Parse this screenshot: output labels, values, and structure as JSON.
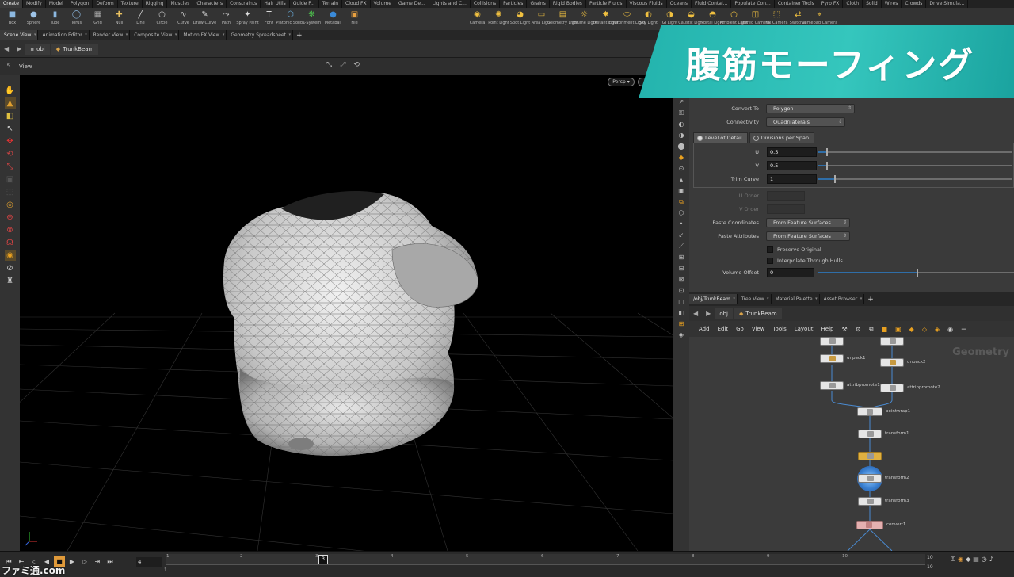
{
  "shelf_tabs": [
    "Create",
    "Modify",
    "Model",
    "Polygon",
    "Deform",
    "Texture",
    "Rigging",
    "Muscles",
    "Characters",
    "Constraints",
    "Hair Utils",
    "Guide P...",
    "Terrain",
    "Cloud FX",
    "Volume",
    "Game De...",
    "Lights and C...",
    "Collisions",
    "Particles",
    "Grains",
    "Rigid Bodies",
    "Particle Fluids",
    "Viscous Fluids",
    "Oceans",
    "Fluid Contai...",
    "Populate Con...",
    "Container Tools",
    "Pyro FX",
    "Cloth",
    "Solid",
    "Wires",
    "Crowds",
    "Drive Simula..."
  ],
  "shelf_tools": [
    "Box",
    "Sphere",
    "Tube",
    "Torus",
    "Grid",
    "Null",
    "Line",
    "Circle",
    "Curve",
    "Draw Curve",
    "Path",
    "Spray Paint",
    "Font",
    "Platonic Solids",
    "L-System",
    "Metaball",
    "File"
  ],
  "light_tools": [
    "Camera",
    "Point Light",
    "Spot Light",
    "Area Light",
    "Geometry Light",
    "Volume Light",
    "Distant Light",
    "Environment Light",
    "Sky Light",
    "GI Light",
    "Caustic Light",
    "Portal Light",
    "Ambient Light",
    "Stereo Camera",
    "VR Camera",
    "Switcher",
    "Gamepad Camera"
  ],
  "pane_tabs": [
    "Scene View",
    "Animation Editor",
    "Render View",
    "Composite View",
    "Motion FX View",
    "Geometry Spreadsheet"
  ],
  "path": {
    "root": "obj",
    "node": "TrunkBeam"
  },
  "viewer": {
    "title": "View",
    "persp": "Persp"
  },
  "banner_text": "腹筋モーフィング",
  "params": {
    "convert_to": {
      "label": "Convert To",
      "value": "Polygon"
    },
    "connectivity": {
      "label": "Connectivity",
      "value": "Quadrilaterals"
    },
    "lod_tabs": [
      "Level of Detail",
      "Divisions per Span"
    ],
    "u": {
      "label": "U",
      "value": "0.5",
      "level": 0.04
    },
    "v": {
      "label": "V",
      "value": "0.5",
      "level": 0.04
    },
    "trim_curve": {
      "label": "Trim Curve",
      "value": "1",
      "level": 0.08
    },
    "u_order": "U Order",
    "v_order": "V Order",
    "paste_coordinates": {
      "label": "Paste Coordinates",
      "value": "From Feature Surfaces"
    },
    "paste_attributes": {
      "label": "Paste Attributes",
      "value": "From Feature Surfaces"
    },
    "preserve_original": "Preserve Original",
    "interpolate_hulls": "Interpolate Through Hulls",
    "volume_offset": {
      "label": "Volume Offset",
      "value": "0",
      "level": 0.5
    }
  },
  "net_tabs": [
    "/obj/TrunkBeam",
    "Tree View",
    "Material Palette",
    "Asset Browser"
  ],
  "net_menu": [
    "Add",
    "Edit",
    "Go",
    "View",
    "Tools",
    "Layout",
    "Help"
  ],
  "net_context": "Geometry",
  "nodes": {
    "unpack1": "unpack1",
    "unpack2": "unpack2",
    "attribpromote1": "attribpromote1",
    "attribpromote2": "attribpromote2",
    "pointwrap1": "pointwrap1",
    "transform1": "transform1",
    "transform2": "transform2",
    "transform3": "transform3",
    "convert1": "convert1"
  },
  "timeline": {
    "frame": "4",
    "start": "1",
    "end_a": "10",
    "end_b": "10",
    "ticks": [
      "1",
      "2",
      "3",
      "4",
      "5",
      "6",
      "7",
      "8",
      "9",
      "10"
    ],
    "current": "3"
  },
  "watermark": "ファミ通.com",
  "colors": {
    "banner": "#2bbdb5",
    "param_bg": "#3a3a3a",
    "viewport_bg": "#000000"
  }
}
